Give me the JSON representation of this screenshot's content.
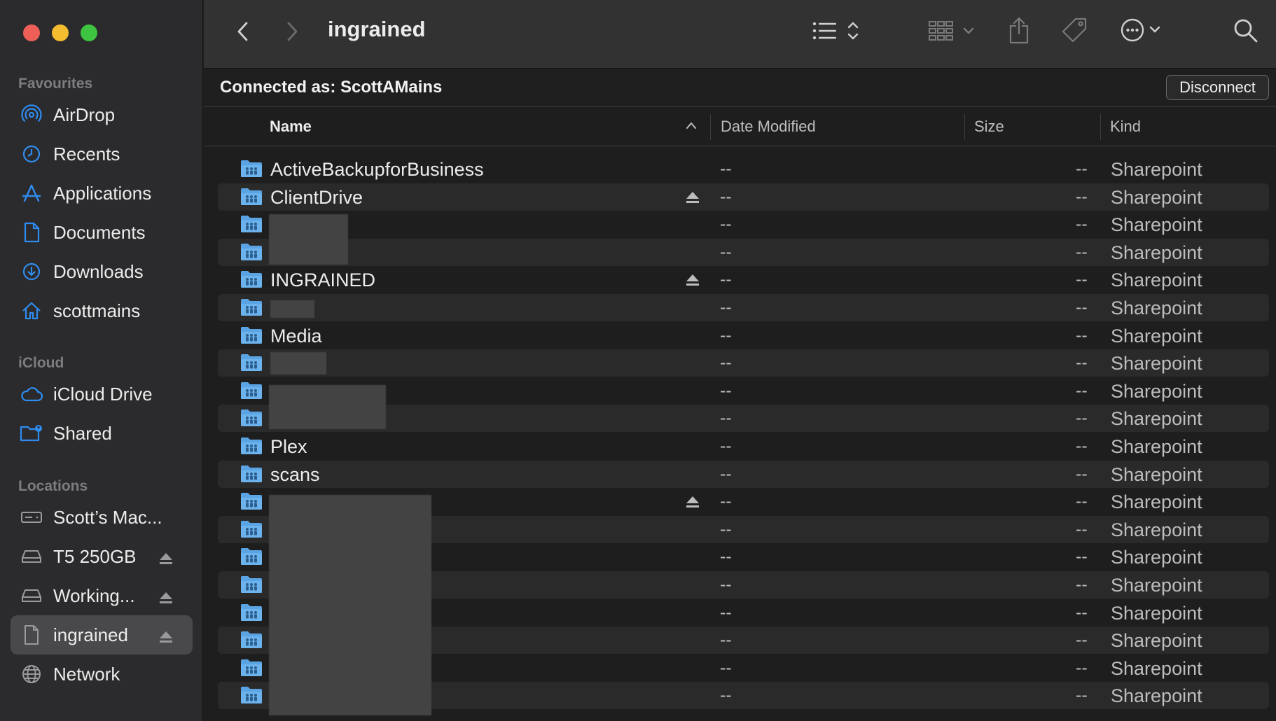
{
  "window": {
    "title": "ingrained"
  },
  "sidebar": {
    "favourites_header": "Favourites",
    "favourites": [
      {
        "label": "AirDrop",
        "icon": "airdrop-icon"
      },
      {
        "label": "Recents",
        "icon": "clock-icon"
      },
      {
        "label": "Applications",
        "icon": "applications-icon"
      },
      {
        "label": "Documents",
        "icon": "document-icon"
      },
      {
        "label": "Downloads",
        "icon": "download-icon"
      },
      {
        "label": "scottmains",
        "icon": "home-icon"
      }
    ],
    "icloud_header": "iCloud",
    "icloud": [
      {
        "label": "iCloud Drive",
        "icon": "cloud-icon"
      },
      {
        "label": "Shared",
        "icon": "shared-folder-icon"
      }
    ],
    "locations_header": "Locations",
    "locations": [
      {
        "label": "Scott’s Mac...",
        "icon": "computer-icon",
        "eject": false
      },
      {
        "label": "T5 250GB",
        "icon": "drive-icon",
        "eject": true
      },
      {
        "label": "Working...",
        "icon": "drive-icon",
        "eject": true
      },
      {
        "label": "ingrained",
        "icon": "server-share-icon",
        "eject": true,
        "selected": true
      },
      {
        "label": "Network",
        "icon": "globe-icon",
        "eject": false
      }
    ]
  },
  "connection": {
    "text": "Connected as: ScottAMains",
    "disconnect_label": "Disconnect"
  },
  "columns": {
    "name": "Name",
    "date": "Date Modified",
    "size": "Size",
    "kind": "Kind"
  },
  "files": [
    {
      "name": "ActiveBackupforBusiness",
      "date": "--",
      "size": "--",
      "kind": "Sharepoint",
      "eject": false
    },
    {
      "name": "ClientDrive",
      "date": "--",
      "size": "--",
      "kind": "Sharepoint",
      "eject": true
    },
    {
      "name": "",
      "date": "--",
      "size": "--",
      "kind": "Sharepoint",
      "eject": false
    },
    {
      "name": "",
      "date": "--",
      "size": "--",
      "kind": "Sharepoint",
      "eject": false
    },
    {
      "name": "INGRAINED",
      "date": "--",
      "size": "--",
      "kind": "Sharepoint",
      "eject": true
    },
    {
      "name": "",
      "date": "--",
      "size": "--",
      "kind": "Sharepoint",
      "eject": false
    },
    {
      "name": "Media",
      "date": "--",
      "size": "--",
      "kind": "Sharepoint",
      "eject": false
    },
    {
      "name": "",
      "date": "--",
      "size": "--",
      "kind": "Sharepoint",
      "eject": false
    },
    {
      "name": "",
      "date": "--",
      "size": "--",
      "kind": "Sharepoint",
      "eject": false
    },
    {
      "name": "",
      "date": "--",
      "size": "--",
      "kind": "Sharepoint",
      "eject": false
    },
    {
      "name": "Plex",
      "date": "--",
      "size": "--",
      "kind": "Sharepoint",
      "eject": false
    },
    {
      "name": "scans",
      "date": "--",
      "size": "--",
      "kind": "Sharepoint",
      "eject": false
    },
    {
      "name": "",
      "date": "--",
      "size": "--",
      "kind": "Sharepoint",
      "eject": true
    },
    {
      "name": "",
      "date": "--",
      "size": "--",
      "kind": "Sharepoint",
      "eject": false
    },
    {
      "name": "",
      "date": "--",
      "size": "--",
      "kind": "Sharepoint",
      "eject": false
    },
    {
      "name": "",
      "date": "--",
      "size": "--",
      "kind": "Sharepoint",
      "eject": false
    },
    {
      "name": "",
      "date": "--",
      "size": "--",
      "kind": "Sharepoint",
      "eject": false
    },
    {
      "name": "",
      "date": "--",
      "size": "--",
      "kind": "Sharepoint",
      "eject": false
    },
    {
      "name": "",
      "date": "--",
      "size": "--",
      "kind": "Sharepoint",
      "eject": false
    },
    {
      "name": "",
      "date": "--",
      "size": "--",
      "kind": "Sharepoint",
      "eject": false
    }
  ],
  "colors": {
    "accent": "#2f8cf0",
    "folder": "#5aa4e3",
    "sidebar_bg": "#2b2b2d",
    "row_alt": "#2a2a2b"
  }
}
